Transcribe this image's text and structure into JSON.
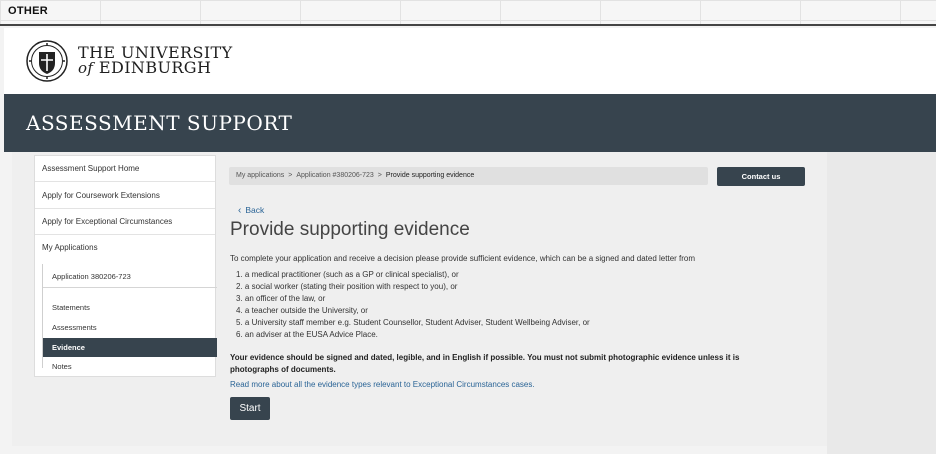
{
  "tag": "OTHER",
  "university": {
    "line1": "THE UNIVERSITY",
    "line2_prefix": "of",
    "line2": "EDINBURGH"
  },
  "banner": {
    "title": "ASSESSMENT SUPPORT"
  },
  "sidebar": {
    "items": [
      {
        "label": "Assessment Support Home"
      },
      {
        "label": "Apply for Coursework Extensions"
      },
      {
        "label": "Apply for Exceptional Circumstances"
      },
      {
        "label": "My Applications"
      }
    ],
    "application": "Application 380206-723",
    "sub_items": [
      {
        "label": "Statements"
      },
      {
        "label": "Assessments"
      },
      {
        "label": "Evidence"
      },
      {
        "label": "Notes"
      }
    ]
  },
  "breadcrumb": {
    "items": [
      "My applications",
      "Application #380206-723",
      "Provide supporting evidence"
    ],
    "separator": ">"
  },
  "contact_label": "Contact us",
  "back_label": "Back",
  "page_title": "Provide supporting evidence",
  "intro": "To complete your application and receive a decision please provide sufficient evidence, which can be a signed and dated letter from",
  "evidence_list": [
    "1. a medical practitioner (such as a GP or clinical specialist), or",
    "2. a social worker (stating their position with respect to you), or",
    "3. an officer of the law, or",
    "4. a teacher outside the University, or",
    "5. a University staff member e.g. Student Counsellor, Student Adviser, Student Wellbeing Adviser, or",
    "6. an adviser at the EUSA Advice Place."
  ],
  "warning": "Your evidence should be signed and dated, legible, and in English if possible. You must not submit photographic evidence unless it is photographs of documents.",
  "read_more": "Read more about all the evidence types relevant to Exceptional Circumstances cases.",
  "start_label": "Start",
  "colors": {
    "brand_dark": "#37444e",
    "link": "#2a6496"
  }
}
